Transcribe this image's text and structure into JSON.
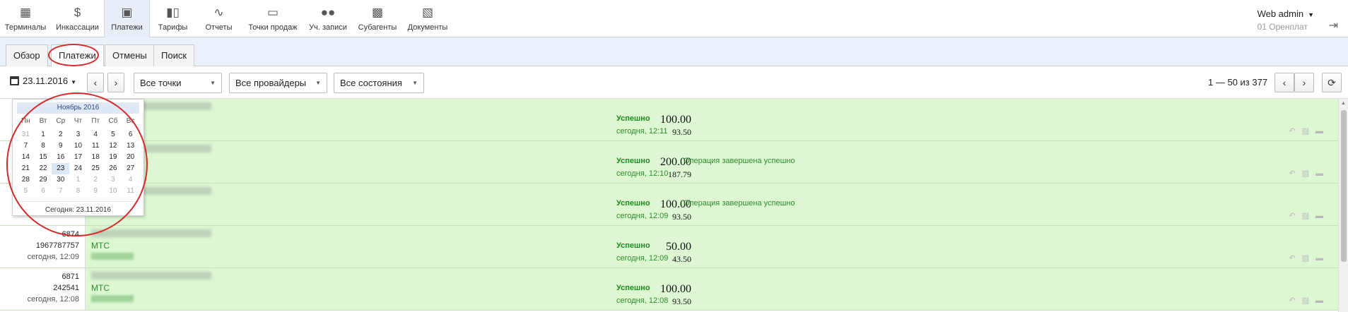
{
  "nav": {
    "items": [
      {
        "label": "Терминалы",
        "icon": "terminal-icon"
      },
      {
        "label": "Инкассации",
        "icon": "dollar-icon"
      },
      {
        "label": "Платежи",
        "icon": "wallet-icon"
      },
      {
        "label": "Тарифы",
        "icon": "bar-chart-icon"
      },
      {
        "label": "Отчеты",
        "icon": "line-chart-icon"
      },
      {
        "label": "Точки продаж",
        "icon": "monitor-icon"
      },
      {
        "label": "Уч. записи",
        "icon": "users-icon"
      },
      {
        "label": "Субагенты",
        "icon": "briefcase-icon"
      },
      {
        "label": "Документы",
        "icon": "printer-icon"
      }
    ],
    "active": "Платежи",
    "user_name": "Web admin",
    "user_sub": "01 Оренплат"
  },
  "tabs": [
    {
      "label": "Обзор"
    },
    {
      "label": "Платежи"
    },
    {
      "label": "Отмены"
    },
    {
      "label": "Поиск"
    }
  ],
  "filters": {
    "date": "23.11.2016",
    "prev": "‹",
    "next": "›",
    "points": "Все точки",
    "providers": "Все провайдеры",
    "states": "Все состояния",
    "pager": "1 — 50 из 377",
    "refresh": "⟳"
  },
  "calendar": {
    "month": "Ноябрь 2016",
    "weekdays": [
      "Пн",
      "Вт",
      "Ср",
      "Чт",
      "Пт",
      "Сб",
      "Вс"
    ],
    "days": [
      "31",
      "1",
      "2",
      "3",
      "4",
      "5",
      "6",
      "7",
      "8",
      "9",
      "10",
      "11",
      "12",
      "13",
      "14",
      "15",
      "16",
      "17",
      "18",
      "19",
      "20",
      "21",
      "22",
      "23",
      "24",
      "25",
      "26",
      "27",
      "28",
      "29",
      "30",
      "1",
      "2",
      "3",
      "4",
      "5",
      "6",
      "7",
      "8",
      "9",
      "10",
      "11"
    ],
    "outside_indices": [
      0,
      31,
      32,
      33,
      34,
      35,
      36,
      37,
      38,
      39,
      40,
      41
    ],
    "selected_index": 23,
    "today_label": "Сегодня: 23.11.2016"
  },
  "payments": [
    {
      "id": "",
      "number": "",
      "time": "",
      "operator": "",
      "amount": "100.00",
      "amount2": "93.50",
      "status": "Успешно",
      "status_time": "сегодня, 12:11",
      "note": ""
    },
    {
      "id": "",
      "number": "",
      "time": "",
      "operator": "",
      "amount": "200.00",
      "amount2": "187.79",
      "status": "Успешно",
      "status_time": "сегодня, 12:10",
      "note": "Операция завершена успешно"
    },
    {
      "id": "",
      "number": "",
      "time": "",
      "operator": "",
      "amount": "100.00",
      "amount2": "93.50",
      "status": "Успешно",
      "status_time": "сегодня, 12:09",
      "note": "Операция завершена успешно"
    },
    {
      "id": "6874",
      "number": "1967787757",
      "time": "сегодня, 12:09",
      "operator": "МТС",
      "amount": "50.00",
      "amount2": "43.50",
      "status": "Успешно",
      "status_time": "сегодня, 12:09",
      "note": ""
    },
    {
      "id": "6871",
      "number": "242541",
      "time": "сегодня, 12:08",
      "operator": "МТС",
      "amount": "100.00",
      "amount2": "93.50",
      "status": "Успешно",
      "status_time": "сегодня, 12:08",
      "note": ""
    }
  ],
  "colors": {
    "row_bg": "#ddf7d3",
    "status_green": "#1f8a1f",
    "annotation_red": "#d42a2a"
  }
}
